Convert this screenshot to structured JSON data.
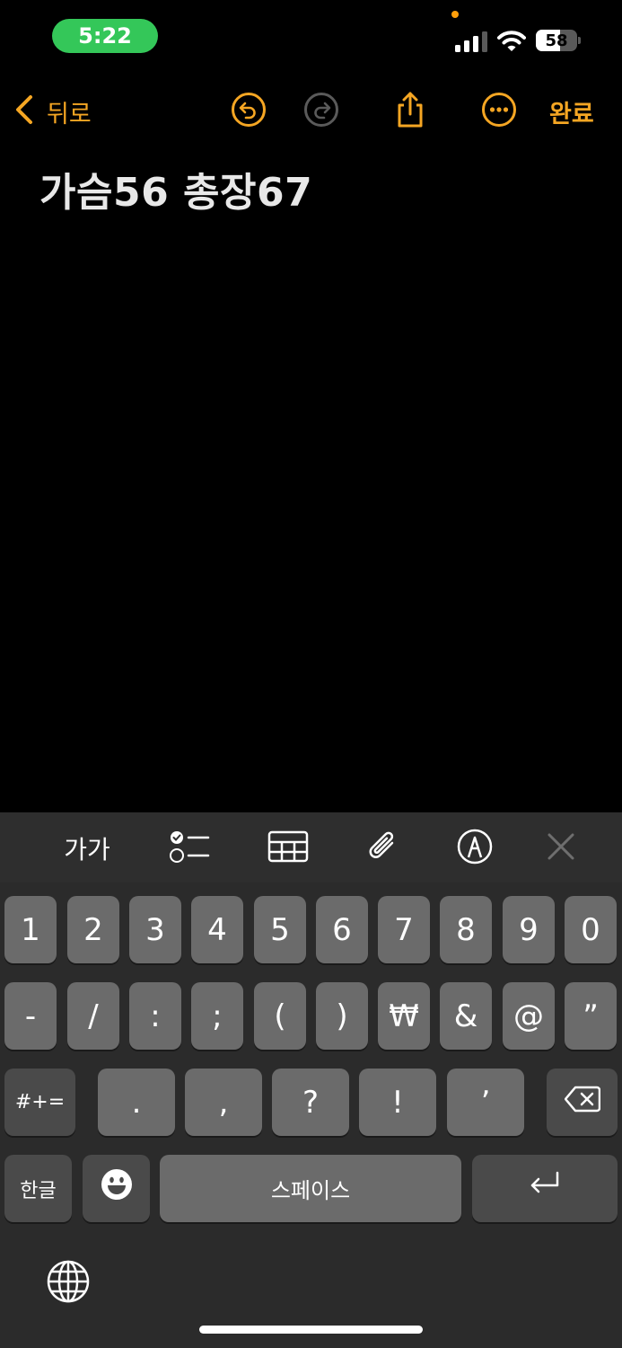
{
  "status_bar": {
    "time": "5:22",
    "battery_level": "58",
    "signal_bars": 3,
    "colors": {
      "time_pill": "#34c759",
      "privacy_dot": "#ff9f0a"
    }
  },
  "nav": {
    "back_label": "뒤로",
    "done_label": "완료",
    "icons": [
      "chevron-left-icon",
      "undo-icon",
      "redo-icon",
      "share-icon",
      "more-icon"
    ],
    "accent_color": "#f5a623"
  },
  "note": {
    "title": "가슴56 총장67"
  },
  "toolbar": {
    "format_label": "가가",
    "icons": [
      "format-icon",
      "checklist-icon",
      "table-icon",
      "attachment-icon",
      "markup-icon",
      "close-icon"
    ]
  },
  "keyboard": {
    "row1": [
      "1",
      "2",
      "3",
      "4",
      "5",
      "6",
      "7",
      "8",
      "9",
      "0"
    ],
    "row2": [
      "-",
      "/",
      ":",
      ";",
      "(",
      ")",
      "₩",
      "&",
      "@",
      "”"
    ],
    "row3": [
      "#+=",
      ".",
      ",",
      "?",
      "!",
      "’"
    ],
    "row4": {
      "lang_label": "한글",
      "space_label": "스페이스"
    },
    "icons": [
      "delete-icon",
      "emoji-icon",
      "return-icon",
      "globe-icon"
    ]
  }
}
